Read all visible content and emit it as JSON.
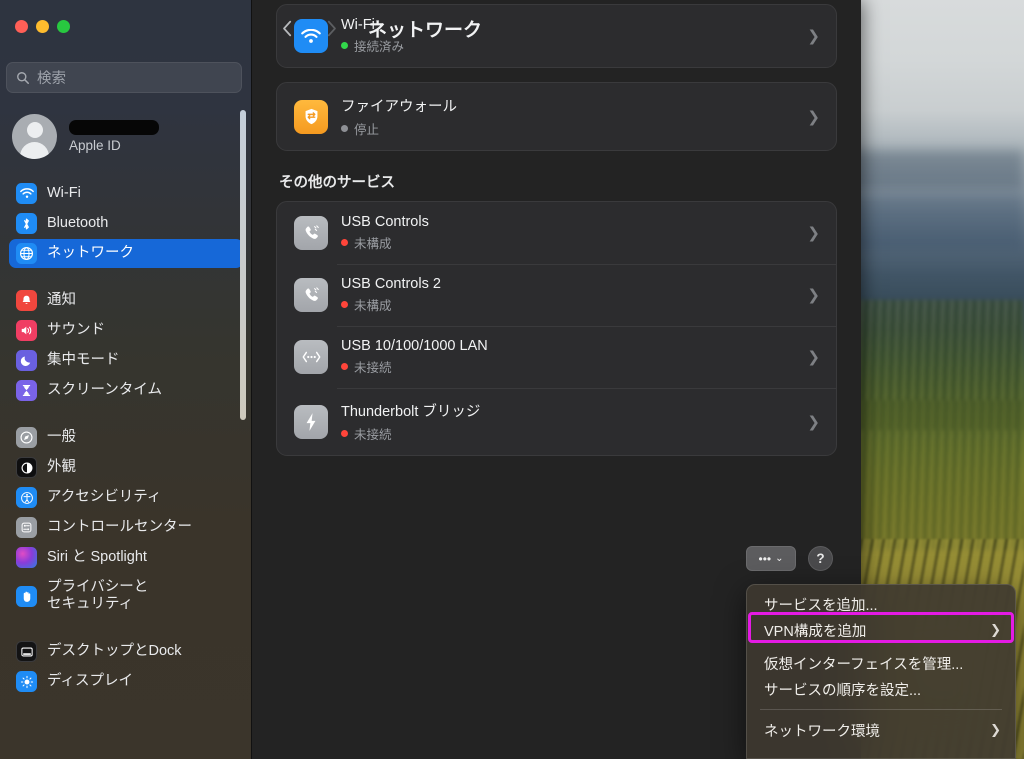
{
  "window": {
    "traffic_lights": [
      "close",
      "minimize",
      "maximize"
    ],
    "colors": {
      "close": "#ff5f57",
      "minimize": "#febc2e",
      "maximize": "#28c840",
      "accent": "#1668d8",
      "highlight": "#e41ae4"
    }
  },
  "sidebar": {
    "search": {
      "placeholder": "検索",
      "icon": "search-icon"
    },
    "apple_id": {
      "name_redacted": "",
      "subtitle": "Apple ID",
      "avatar_icon": "person-avatar-icon"
    },
    "groups": [
      {
        "items": [
          {
            "label": "Wi-Fi",
            "icon": "wifi-icon",
            "selected": false
          },
          {
            "label": "Bluetooth",
            "icon": "bluetooth-icon",
            "selected": false
          },
          {
            "label": "ネットワーク",
            "icon": "network-globe-icon",
            "selected": true
          }
        ]
      },
      {
        "items": [
          {
            "label": "通知",
            "icon": "bell-icon",
            "selected": false
          },
          {
            "label": "サウンド",
            "icon": "speaker-icon",
            "selected": false
          },
          {
            "label": "集中モード",
            "icon": "moon-icon",
            "selected": false
          },
          {
            "label": "スクリーンタイム",
            "icon": "hourglass-icon",
            "selected": false
          }
        ]
      },
      {
        "items": [
          {
            "label": "一般",
            "icon": "gear-compass-icon",
            "selected": false
          },
          {
            "label": "外観",
            "icon": "appearance-contrast-icon",
            "selected": false
          },
          {
            "label": "アクセシビリティ",
            "icon": "accessibility-icon",
            "selected": false
          },
          {
            "label": "コントロールセンター",
            "icon": "control-center-icon",
            "selected": false
          },
          {
            "label": "Siri と Spotlight",
            "icon": "siri-icon",
            "selected": false
          },
          {
            "label": "プライバシーと\nセキュリティ",
            "label_line1": "プライバシーと",
            "label_line2": "セキュリティ",
            "icon": "hand-privacy-icon",
            "selected": false
          }
        ]
      },
      {
        "items": [
          {
            "label": "デスクトップとDock",
            "icon": "desktop-dock-icon",
            "selected": false
          },
          {
            "label": "ディスプレイ",
            "icon": "display-brightness-icon",
            "selected": false
          }
        ]
      }
    ]
  },
  "main": {
    "nav": {
      "back_icon": "chevron-left-icon",
      "forward_icon": "chevron-right-icon"
    },
    "title": "ネットワーク",
    "primary_services": [
      {
        "name": "Wi-Fi",
        "status": "接続済み",
        "status_color": "#32d74b",
        "icon": "wifi-icon",
        "chevron": "chevron-right-icon"
      },
      {
        "name": "ファイアウォール",
        "status": "停止",
        "status_color": "#8e9095",
        "icon": "firewall-shield-icon",
        "chevron": "chevron-right-icon"
      }
    ],
    "other_services_header": "その他のサービス",
    "other_services": [
      {
        "name": "USB Controls",
        "status": "未構成",
        "status_color": "#ff453a",
        "icon": "phone-handset-icon",
        "chevron": "chevron-right-icon"
      },
      {
        "name": "USB Controls 2",
        "status": "未構成",
        "status_color": "#ff453a",
        "icon": "phone-handset-icon",
        "chevron": "chevron-right-icon"
      },
      {
        "name": "USB 10/100/1000 LAN",
        "status": "未接続",
        "status_color": "#ff453a",
        "icon": "ethernet-icon",
        "chevron": "chevron-right-icon"
      },
      {
        "name": "Thunderbolt ブリッジ",
        "status": "未接続",
        "status_color": "#ff453a",
        "icon": "thunderbolt-icon",
        "chevron": "chevron-right-icon"
      }
    ],
    "more_button": {
      "label": "•••",
      "chevron": "⌄",
      "icon": "ellipsis-dropdown-icon"
    },
    "help_button": {
      "label": "?",
      "icon": "help-question-icon"
    }
  },
  "context_menu": {
    "items": [
      {
        "label": "サービスを追加...",
        "submenu": false,
        "highlighted": false
      },
      {
        "label": "VPN構成を追加",
        "submenu": true,
        "submenu_chevron": "❯",
        "highlighted": true
      },
      {
        "label": "仮想インターフェイスを管理...",
        "submenu": false,
        "highlighted": false
      },
      {
        "label": "サービスの順序を設定...",
        "submenu": false,
        "highlighted": false
      },
      {
        "label": "ネットワーク環境",
        "submenu": true,
        "submenu_chevron": "❯",
        "highlighted": false
      }
    ]
  }
}
